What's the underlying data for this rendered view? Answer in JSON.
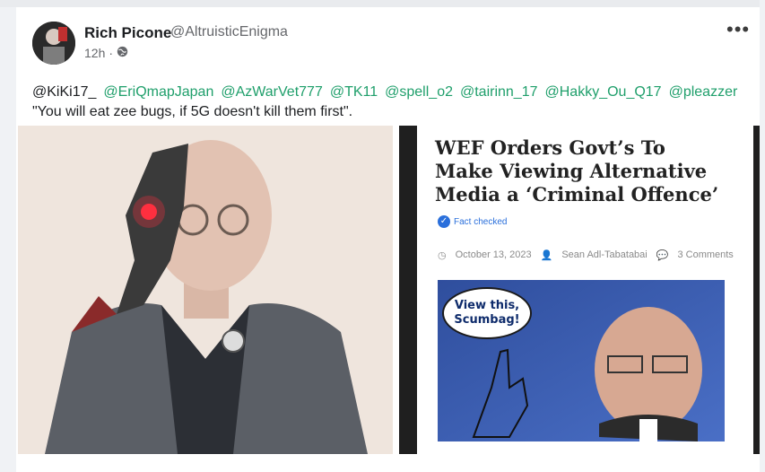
{
  "post": {
    "author_name": "Rich Picone",
    "author_handle": "@AltruisticEnigma",
    "timestamp": "12h",
    "visibility_icon": "globe-icon",
    "more_icon": "more-icon",
    "mentions": [
      "@KiKi17_",
      "@EriQmapJapan",
      "@AzWarVet777",
      "@TK11",
      "@spell_o2",
      "@tairinn_17",
      "@Hakky_Ou_Q17",
      "@pleazzer"
    ],
    "body_text": "\"You will eat zee bugs, if 5G doesn't kill them first\"."
  },
  "article": {
    "title": "WEF Orders Govt’s To Make Viewing Alternative Media a ‘Criminal Offence’",
    "fact_checked": "Fact checked",
    "date": "October 13, 2023",
    "author": "Sean Adl-Tabatabai",
    "comments": "3 Comments",
    "bubble_line1": "View this,",
    "bubble_line2": "Scumbag!"
  },
  "colors": {
    "mention": "#1f9f6b",
    "fact_check": "#2a6fdb",
    "article_image_bg": "#3b62b8"
  }
}
